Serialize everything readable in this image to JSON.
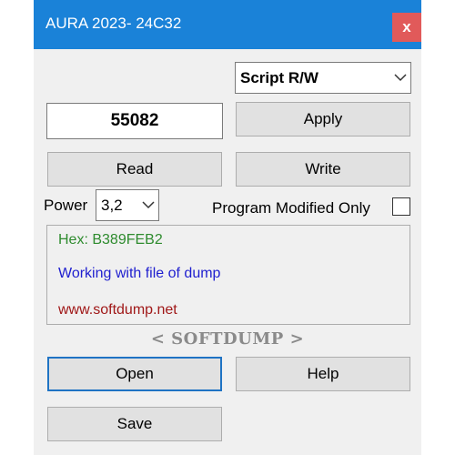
{
  "window": {
    "title": "AURA 2023- 24C32",
    "close_label": "x",
    "accent_color": "#1a82d8",
    "close_color": "#e15a5a"
  },
  "mode_select": {
    "selected": "Script R/W"
  },
  "value_display": {
    "value": "55082"
  },
  "buttons": {
    "apply": "Apply",
    "read": "Read",
    "write": "Write",
    "open": "Open",
    "help": "Help",
    "save": "Save"
  },
  "power": {
    "label": "Power",
    "selected": "3,2"
  },
  "program_modified": {
    "label": "Program Modified Only",
    "checked": false
  },
  "info": {
    "hex": {
      "text": "Hex: B389FEB2",
      "color": "#2e8b2e"
    },
    "status": {
      "text": "Working with file of dump",
      "color": "#1f1fcf"
    },
    "website": {
      "text": "www.softdump.net",
      "color": "#a01818"
    }
  },
  "brand": {
    "text": "< SOFTDUMP >"
  }
}
